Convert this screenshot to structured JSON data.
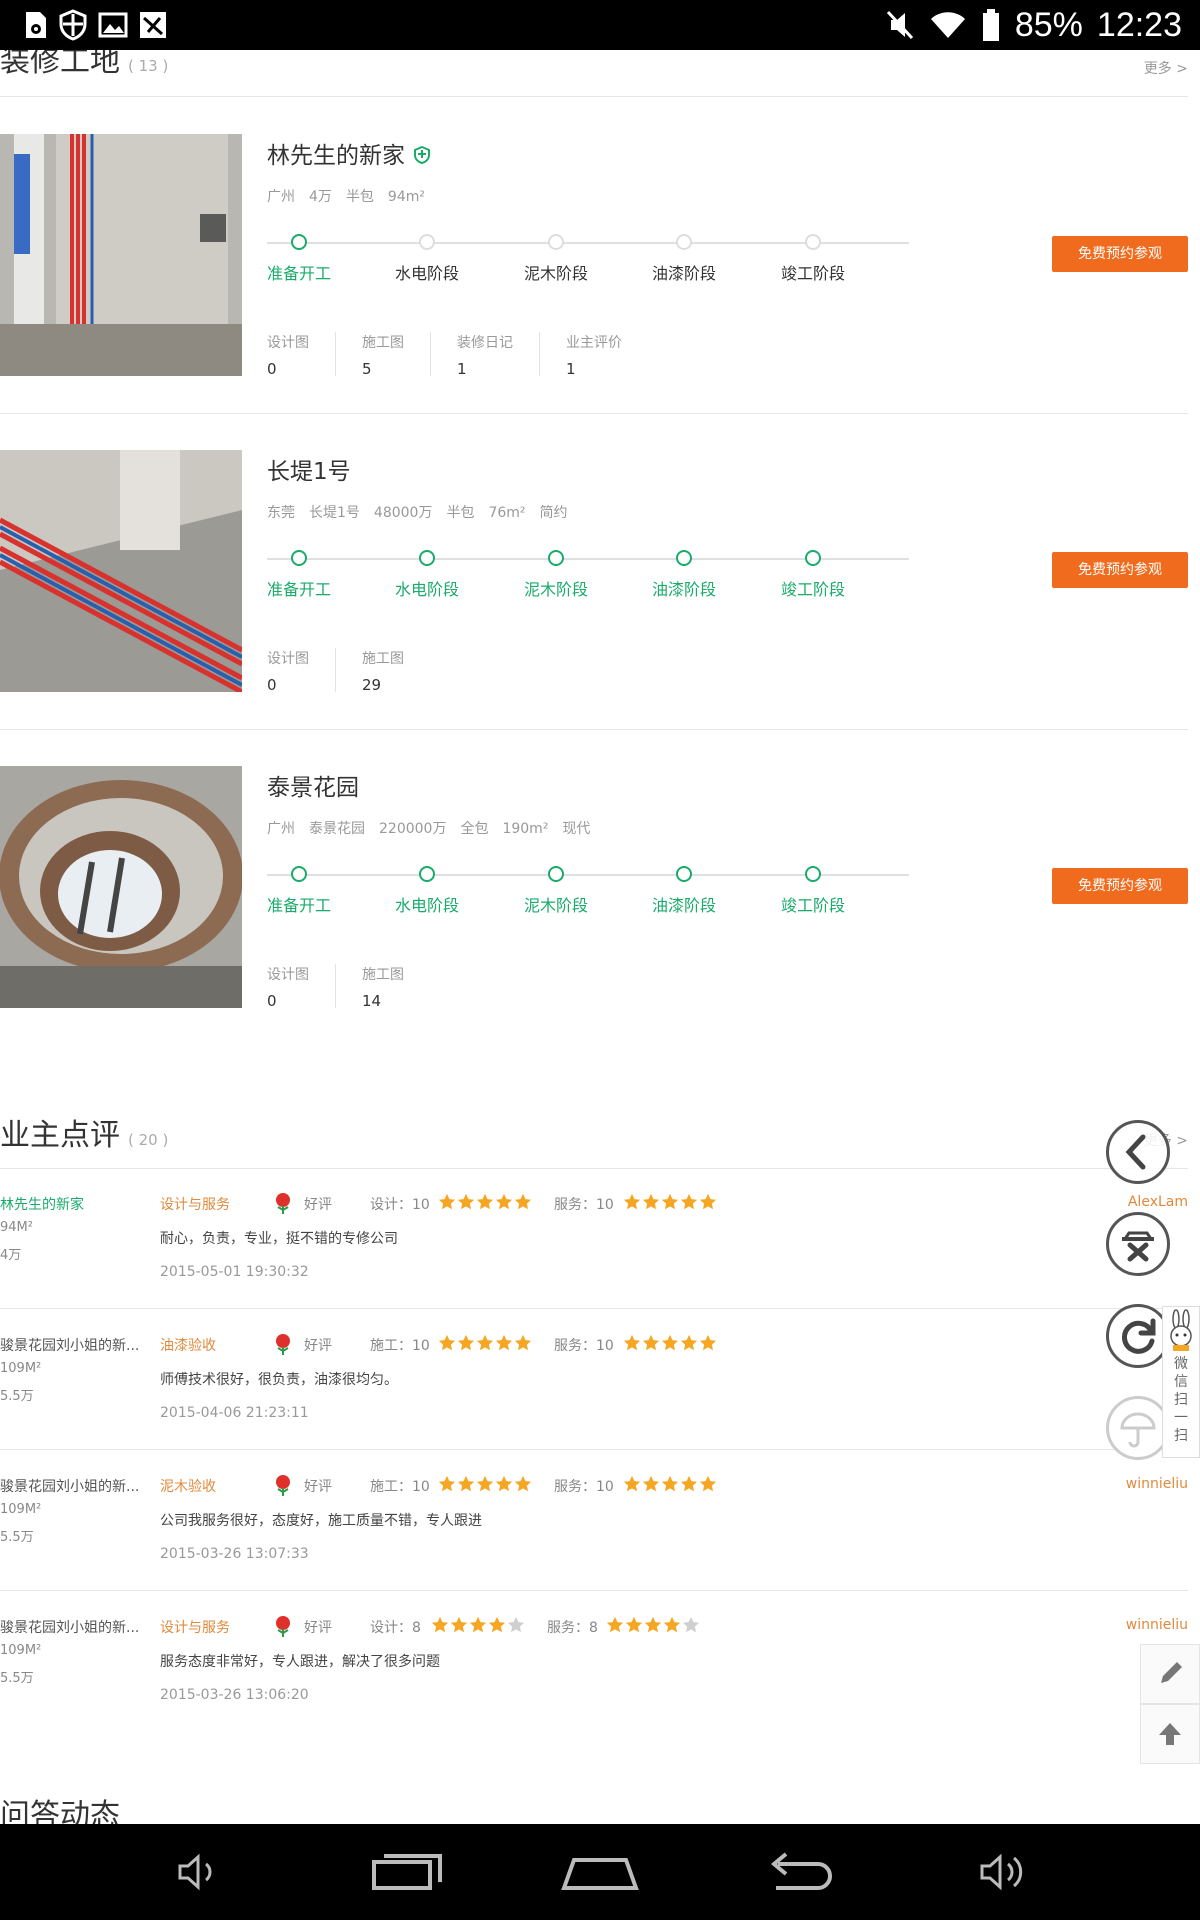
{
  "status_bar": {
    "battery": "85%",
    "time": "12:23"
  },
  "sites_section": {
    "title": "装修工地",
    "count": "( 13 )",
    "more": "更多 >"
  },
  "sites": [
    {
      "name": "林先生的新家",
      "meta": [
        "广州",
        "4万",
        "半包",
        "94m²"
      ],
      "steps": [
        "准备开工",
        "水电阶段",
        "泥木阶段",
        "油漆阶段",
        "竣工阶段"
      ],
      "steps_done": [
        true,
        false,
        false,
        false,
        false
      ],
      "button": "免费预约参观",
      "stats": [
        {
          "label": "设计图",
          "value": "0"
        },
        {
          "label": "施工图",
          "value": "5"
        },
        {
          "label": "装修日记",
          "value": "1"
        },
        {
          "label": "业主评价",
          "value": "1"
        }
      ]
    },
    {
      "name": "长堤1号",
      "meta": [
        "东莞",
        "长堤1号",
        "48000万",
        "半包",
        "76m²",
        "简约"
      ],
      "steps": [
        "准备开工",
        "水电阶段",
        "泥木阶段",
        "油漆阶段",
        "竣工阶段"
      ],
      "steps_done": [
        true,
        true,
        true,
        true,
        true
      ],
      "button": "免费预约参观",
      "stats": [
        {
          "label": "设计图",
          "value": "0"
        },
        {
          "label": "施工图",
          "value": "29"
        }
      ]
    },
    {
      "name": "泰景花园",
      "meta": [
        "广州",
        "泰景花园",
        "220000万",
        "全包",
        "190m²",
        "现代"
      ],
      "steps": [
        "准备开工",
        "水电阶段",
        "泥木阶段",
        "油漆阶段",
        "竣工阶段"
      ],
      "steps_done": [
        true,
        true,
        true,
        true,
        true
      ],
      "button": "免费预约参观",
      "stats": [
        {
          "label": "设计图",
          "value": "0"
        },
        {
          "label": "施工图",
          "value": "14"
        }
      ]
    }
  ],
  "reviews_section": {
    "title": "业主点评",
    "count": "( 20 )",
    "more": "更多 >"
  },
  "reviews": [
    {
      "owner": "林先生的新家",
      "area": "94M²",
      "budget": "4万",
      "stage": "设计与服务",
      "good": "好评",
      "score1": "设计：10",
      "stars1": 5,
      "score2": "服务：10",
      "stars2": 5,
      "text": "耐心，负责，专业，挺不错的专修公司",
      "time": "2015-05-01 19:30:32",
      "author": "AlexLam"
    },
    {
      "owner": "骏景花园刘小姐的新...",
      "area": "109M²",
      "budget": "5.5万",
      "stage": "油漆验收",
      "good": "好评",
      "score1": "施工：10",
      "stars1": 5,
      "score2": "服务：10",
      "stars2": 5,
      "text": "师傅技术很好，很负责，油漆很均匀。",
      "time": "2015-04-06 21:23:11",
      "author": ""
    },
    {
      "owner": "骏景花园刘小姐的新...",
      "area": "109M²",
      "budget": "5.5万",
      "stage": "泥木验收",
      "good": "好评",
      "score1": "施工：10",
      "stars1": 5,
      "score2": "服务：10",
      "stars2": 5,
      "text": "公司我服务很好，态度好，施工质量不错，专人跟进",
      "time": "2015-03-26 13:07:33",
      "author": "winnieliu"
    },
    {
      "owner": "骏景花园刘小姐的新...",
      "area": "109M²",
      "budget": "5.5万",
      "stage": "设计与服务",
      "good": "好评",
      "score1": "设计：8",
      "stars1": 4,
      "score2": "服务：8",
      "stars2": 4,
      "text": "服务态度非常好，专人跟进，解决了很多问题",
      "time": "2015-03-26 13:06:20",
      "author": "winnieliu"
    }
  ],
  "qa_section": {
    "title": "问答动态"
  },
  "side_tab": {
    "label": "微信扫一扫"
  },
  "colors": {
    "green": "#1aab6b",
    "orange_button": "#f06b1d",
    "orange_text": "#e08a3c",
    "star": "#f5a623"
  }
}
